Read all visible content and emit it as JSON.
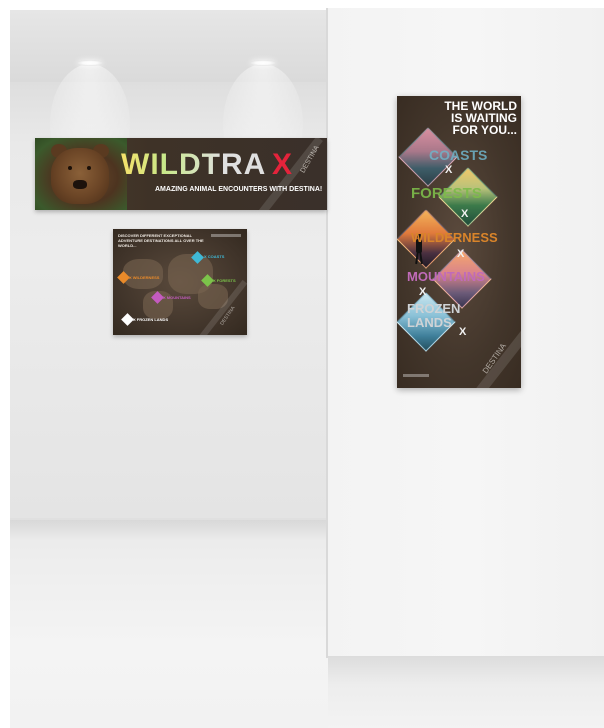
{
  "scene": {
    "colors": {
      "wall": "#ebebeb",
      "accent_red": "#e4233b",
      "poster_bg": "#43362b"
    }
  },
  "banner": {
    "title": "WILDTRA",
    "title_x": "X",
    "subtitle": "AMAZING ANIMAL ENCOUNTERS WITH DESTINA!",
    "brand": "DESTINA",
    "icon": "bear-photo"
  },
  "map_poster": {
    "heading": "DISCOVER DIFFERENT EXCEPTIONAL ADVENTURE DESTINATIONS ALL OVER THE WORLD...",
    "labels": [
      {
        "text": "X COASTS",
        "color": "#3fb9d6"
      },
      {
        "text": "X WILDERNESS",
        "color": "#e98a2a"
      },
      {
        "text": "X FORESTS",
        "color": "#7cc44a"
      },
      {
        "text": "X MOUNTAINS",
        "color": "#c45bbf"
      },
      {
        "text": "X FROZEN LANDS",
        "color": "#ffffff"
      }
    ],
    "brand": "DESTINA"
  },
  "tall_poster": {
    "heading_lines": [
      "THE WORLD",
      "IS WAITING",
      "FOR YOU..."
    ],
    "words": [
      {
        "text": "COASTS",
        "color": "#6fb3c9"
      },
      {
        "text": "FORESTS",
        "color": "#7dbb4a"
      },
      {
        "text": "WILDERNESS",
        "color": "#d9842a"
      },
      {
        "text": "MOUNTAINS",
        "color": "#c06bb9"
      },
      {
        "text": "FROZEN",
        "color": "#cfd3d6"
      },
      {
        "text": "LANDS",
        "color": "#cfd3d6"
      }
    ],
    "separator": "X",
    "brand": "DESTINA"
  }
}
